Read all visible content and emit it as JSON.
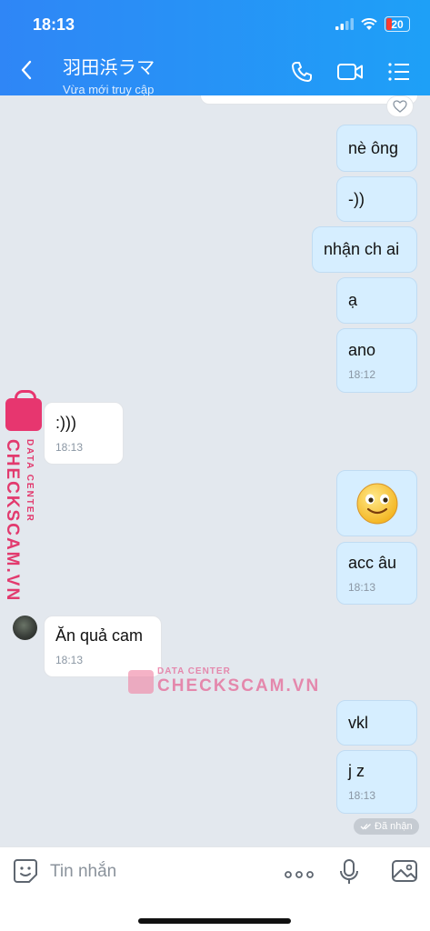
{
  "status_bar": {
    "time": "18:13",
    "battery": "20"
  },
  "header": {
    "title": "羽田浜ラマ",
    "subtitle": "Vừa mới truy cập"
  },
  "messages": [
    {
      "text": "nè ông"
    },
    {
      "text": "-))"
    },
    {
      "text": "nhận ch ai"
    },
    {
      "text": "ạ"
    },
    {
      "text": "ano",
      "time": "18:12"
    },
    {
      "text": ":)))",
      "time": "18:13"
    },
    {
      "text": "🙂"
    },
    {
      "text": "acc âu",
      "time": "18:13"
    },
    {
      "text": "Ăn quả cam",
      "time": "18:13"
    },
    {
      "text": "vkl"
    },
    {
      "text": "j z",
      "time": "18:13"
    }
  ],
  "delivery_status": "Đã nhận",
  "watermark": {
    "brand": "CHECKSCAM.VN",
    "sub": "DATA CENTER"
  },
  "input": {
    "placeholder": "Tin nhắn"
  },
  "colors": {
    "header": "#2f86f6",
    "my_bubble": "#d6eeff",
    "their_bubble": "#ffffff",
    "watermark": "#e23a6e"
  }
}
